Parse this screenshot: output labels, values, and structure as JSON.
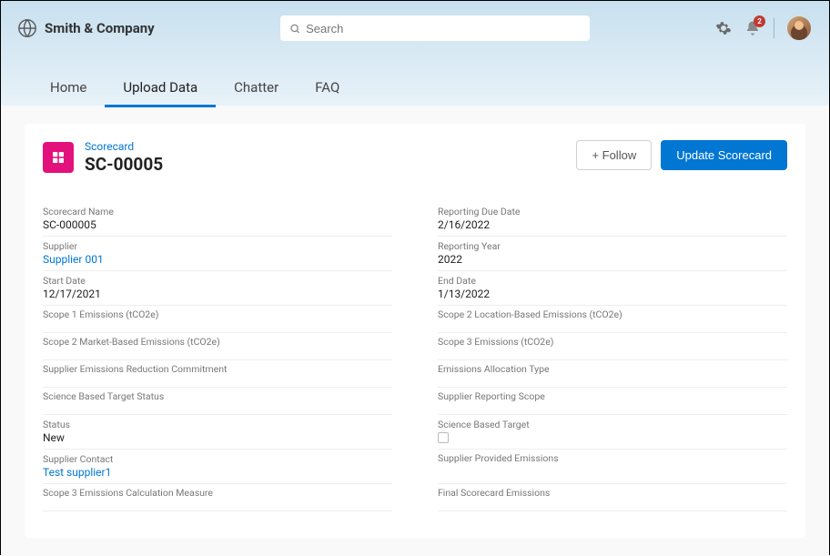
{
  "brand": "Smith & Company",
  "search": {
    "placeholder": "Search"
  },
  "notifications": {
    "count": "2"
  },
  "nav": {
    "home": "Home",
    "upload": "Upload Data",
    "chatter": "Chatter",
    "faq": "FAQ"
  },
  "record": {
    "object_label": "Scorecard",
    "name": "SC-00005"
  },
  "buttons": {
    "follow": "+ Follow",
    "update": "Update Scorecard"
  },
  "fields": {
    "scorecard_name": {
      "label": "Scorecard Name",
      "value": "SC-000005"
    },
    "reporting_due_date": {
      "label": "Reporting Due Date",
      "value": "2/16/2022"
    },
    "supplier": {
      "label": "Supplier",
      "value": "Supplier 001"
    },
    "reporting_year": {
      "label": "Reporting Year",
      "value": "2022"
    },
    "start_date": {
      "label": "Start Date",
      "value": "12/17/2021"
    },
    "end_date": {
      "label": "End Date",
      "value": "1/13/2022"
    },
    "scope1": {
      "label": "Scope 1 Emissions (tCO2e)",
      "value": ""
    },
    "scope2_loc": {
      "label": "Scope 2 Location-Based Emissions (tCO2e)",
      "value": ""
    },
    "scope2_mkt": {
      "label": "Scope 2 Market-Based Emissions (tCO2e)",
      "value": ""
    },
    "scope3": {
      "label": "Scope 3 Emissions (tCO2e)",
      "value": ""
    },
    "commitment": {
      "label": "Supplier Emissions Reduction Commitment",
      "value": ""
    },
    "allocation": {
      "label": "Emissions Allocation Type",
      "value": ""
    },
    "sbt_status": {
      "label": "Science Based Target Status",
      "value": ""
    },
    "reporting_scope": {
      "label": "Supplier Reporting Scope",
      "value": ""
    },
    "status": {
      "label": "Status",
      "value": "New"
    },
    "sbt": {
      "label": "Science Based Target",
      "value": ""
    },
    "contact": {
      "label": "Supplier Contact",
      "value": "Test supplier1"
    },
    "provided": {
      "label": "Supplier Provided Emissions",
      "value": ""
    },
    "scope3_calc": {
      "label": "Scope 3 Emissions Calculation Measure",
      "value": ""
    },
    "final": {
      "label": "Final Scorecard Emissions",
      "value": ""
    }
  }
}
